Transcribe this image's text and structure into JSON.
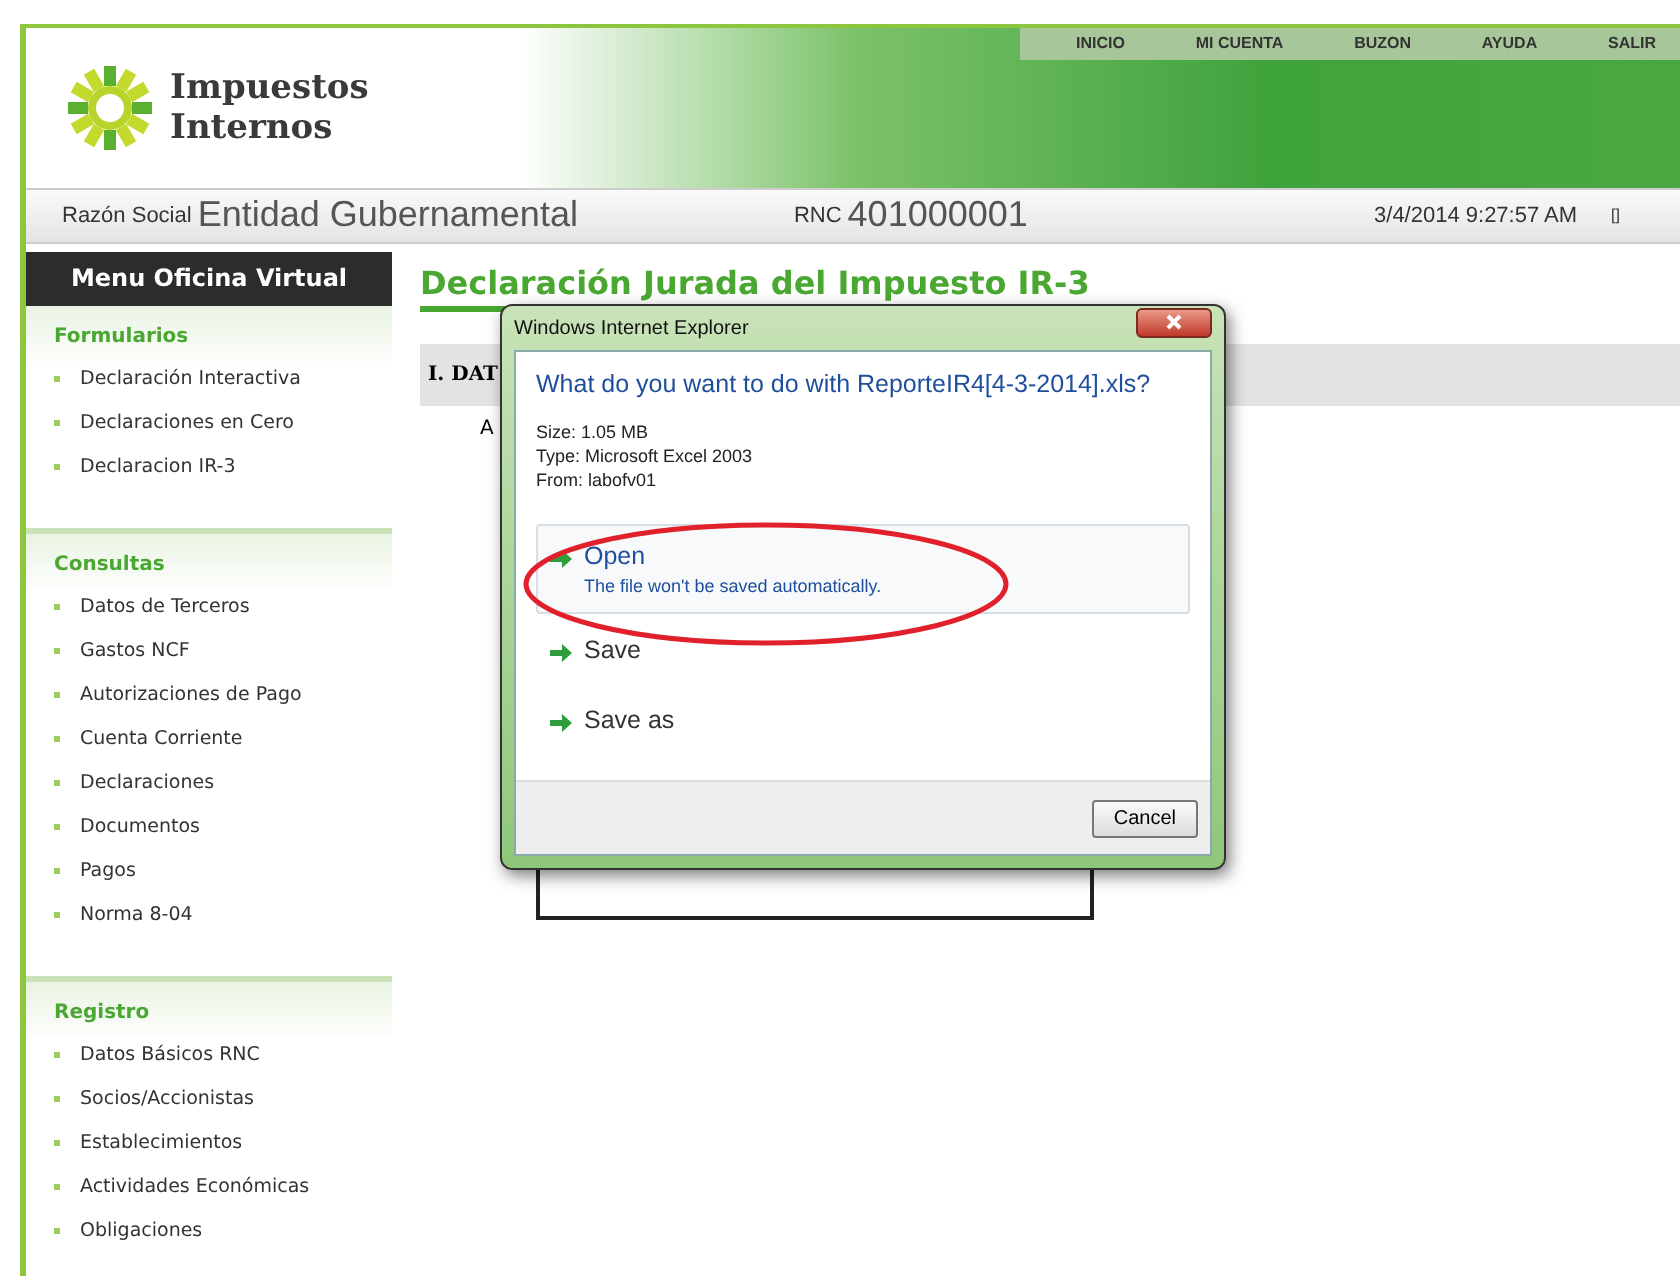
{
  "header": {
    "logo_line1": "Impuestos",
    "logo_line2": "Internos",
    "nav": [
      "INICIO",
      "MI CUENTA",
      "BUZON",
      "AYUDA",
      "SALIR"
    ]
  },
  "info_bar": {
    "razon_label": "Razón Social",
    "razon_value": "Entidad Gubernamental",
    "rnc_label": "RNC",
    "rnc_value": "401000001",
    "datetime": "3/4/2014 9:27:57 AM",
    "marker": "[]"
  },
  "sidebar": {
    "title": "Menu Oficina Virtual",
    "sections": [
      {
        "heading": "Formularios",
        "items": [
          "Declaración Interactiva",
          "Declaraciones en Cero",
          "Declaracion IR-3"
        ]
      },
      {
        "heading": "Consultas",
        "items": [
          "Datos de Terceros",
          "Gastos NCF",
          "Autorizaciones de Pago",
          "Cuenta Corriente",
          "Declaraciones",
          "Documentos",
          "Pagos",
          "Norma 8-04"
        ]
      },
      {
        "heading": "Registro",
        "items": [
          "Datos Básicos RNC",
          "Socios/Accionistas",
          "Establecimientos",
          "Actividades Económicas",
          "Obligaciones"
        ]
      }
    ]
  },
  "content": {
    "title": "Declaración Jurada del Impuesto IR-3",
    "section": "I. DAT",
    "label": "A"
  },
  "dialog": {
    "title": "Windows Internet Explorer",
    "question": "What do you want to do with ReporteIR4[4-3-2014].xls?",
    "details": [
      "Size: 1.05 MB",
      "Type: Microsoft Excel 2003",
      "From: labofv01"
    ],
    "options": [
      {
        "label": "Open",
        "note": "The file won't be saved automatically.",
        "highlighted": true
      },
      {
        "label": "Save",
        "highlighted": false
      },
      {
        "label": "Save as",
        "highlighted": false
      }
    ],
    "cancel": "Cancel"
  }
}
